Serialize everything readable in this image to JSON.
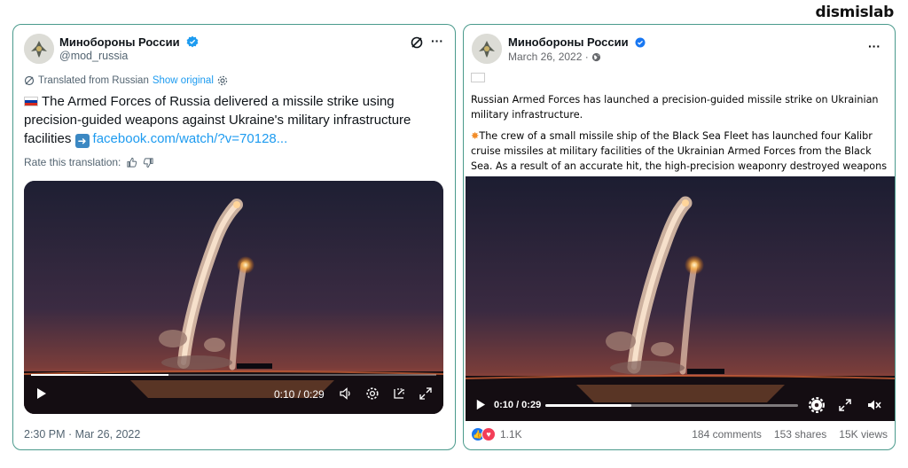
{
  "brand": "dismislab",
  "twitter": {
    "display_name": "Минобороны России",
    "handle": "@mod_russia",
    "translated_from": "Translated from Russian",
    "show_original": "Show original",
    "text": "The Armed Forces of Russia delivered a missile strike using precision-guided weapons against Ukraine's military infrastructure facilities",
    "link": "facebook.com/watch/?v=70128...",
    "rate_label": "Rate this translation:",
    "video": {
      "time": "0:10 / 0:29",
      "progress": 0.34
    },
    "timestamp": "2:30 PM · Mar 26, 2022"
  },
  "facebook": {
    "display_name": "Минобороны России",
    "date": "March 26, 2022 ·",
    "paragraph1": "Russian Armed Forces has launched a precision-guided missile strike on Ukrainian military infrastructure.",
    "paragraph2": "The crew of a small missile ship of the Black Sea Fleet has launched four Kalibr cruise missiles at military facilities of the Ukrainian Armed Forces from the Black Sea. As a result of an accurate hit, the high-precision weaponry destroyed weapons and military equipment depot on the territory of Zhitomir Region.",
    "video": {
      "time": "0:10 / 0:29",
      "progress": 0.34
    },
    "reactions_count": "1.1K",
    "comments": "184 comments",
    "shares": "153 shares",
    "views": "15K views"
  },
  "colors": {
    "verified": "#1d9bf0",
    "fb_verified": "#1877f2",
    "link": "#1d9bf0",
    "card_border": "#4a9a8c"
  }
}
